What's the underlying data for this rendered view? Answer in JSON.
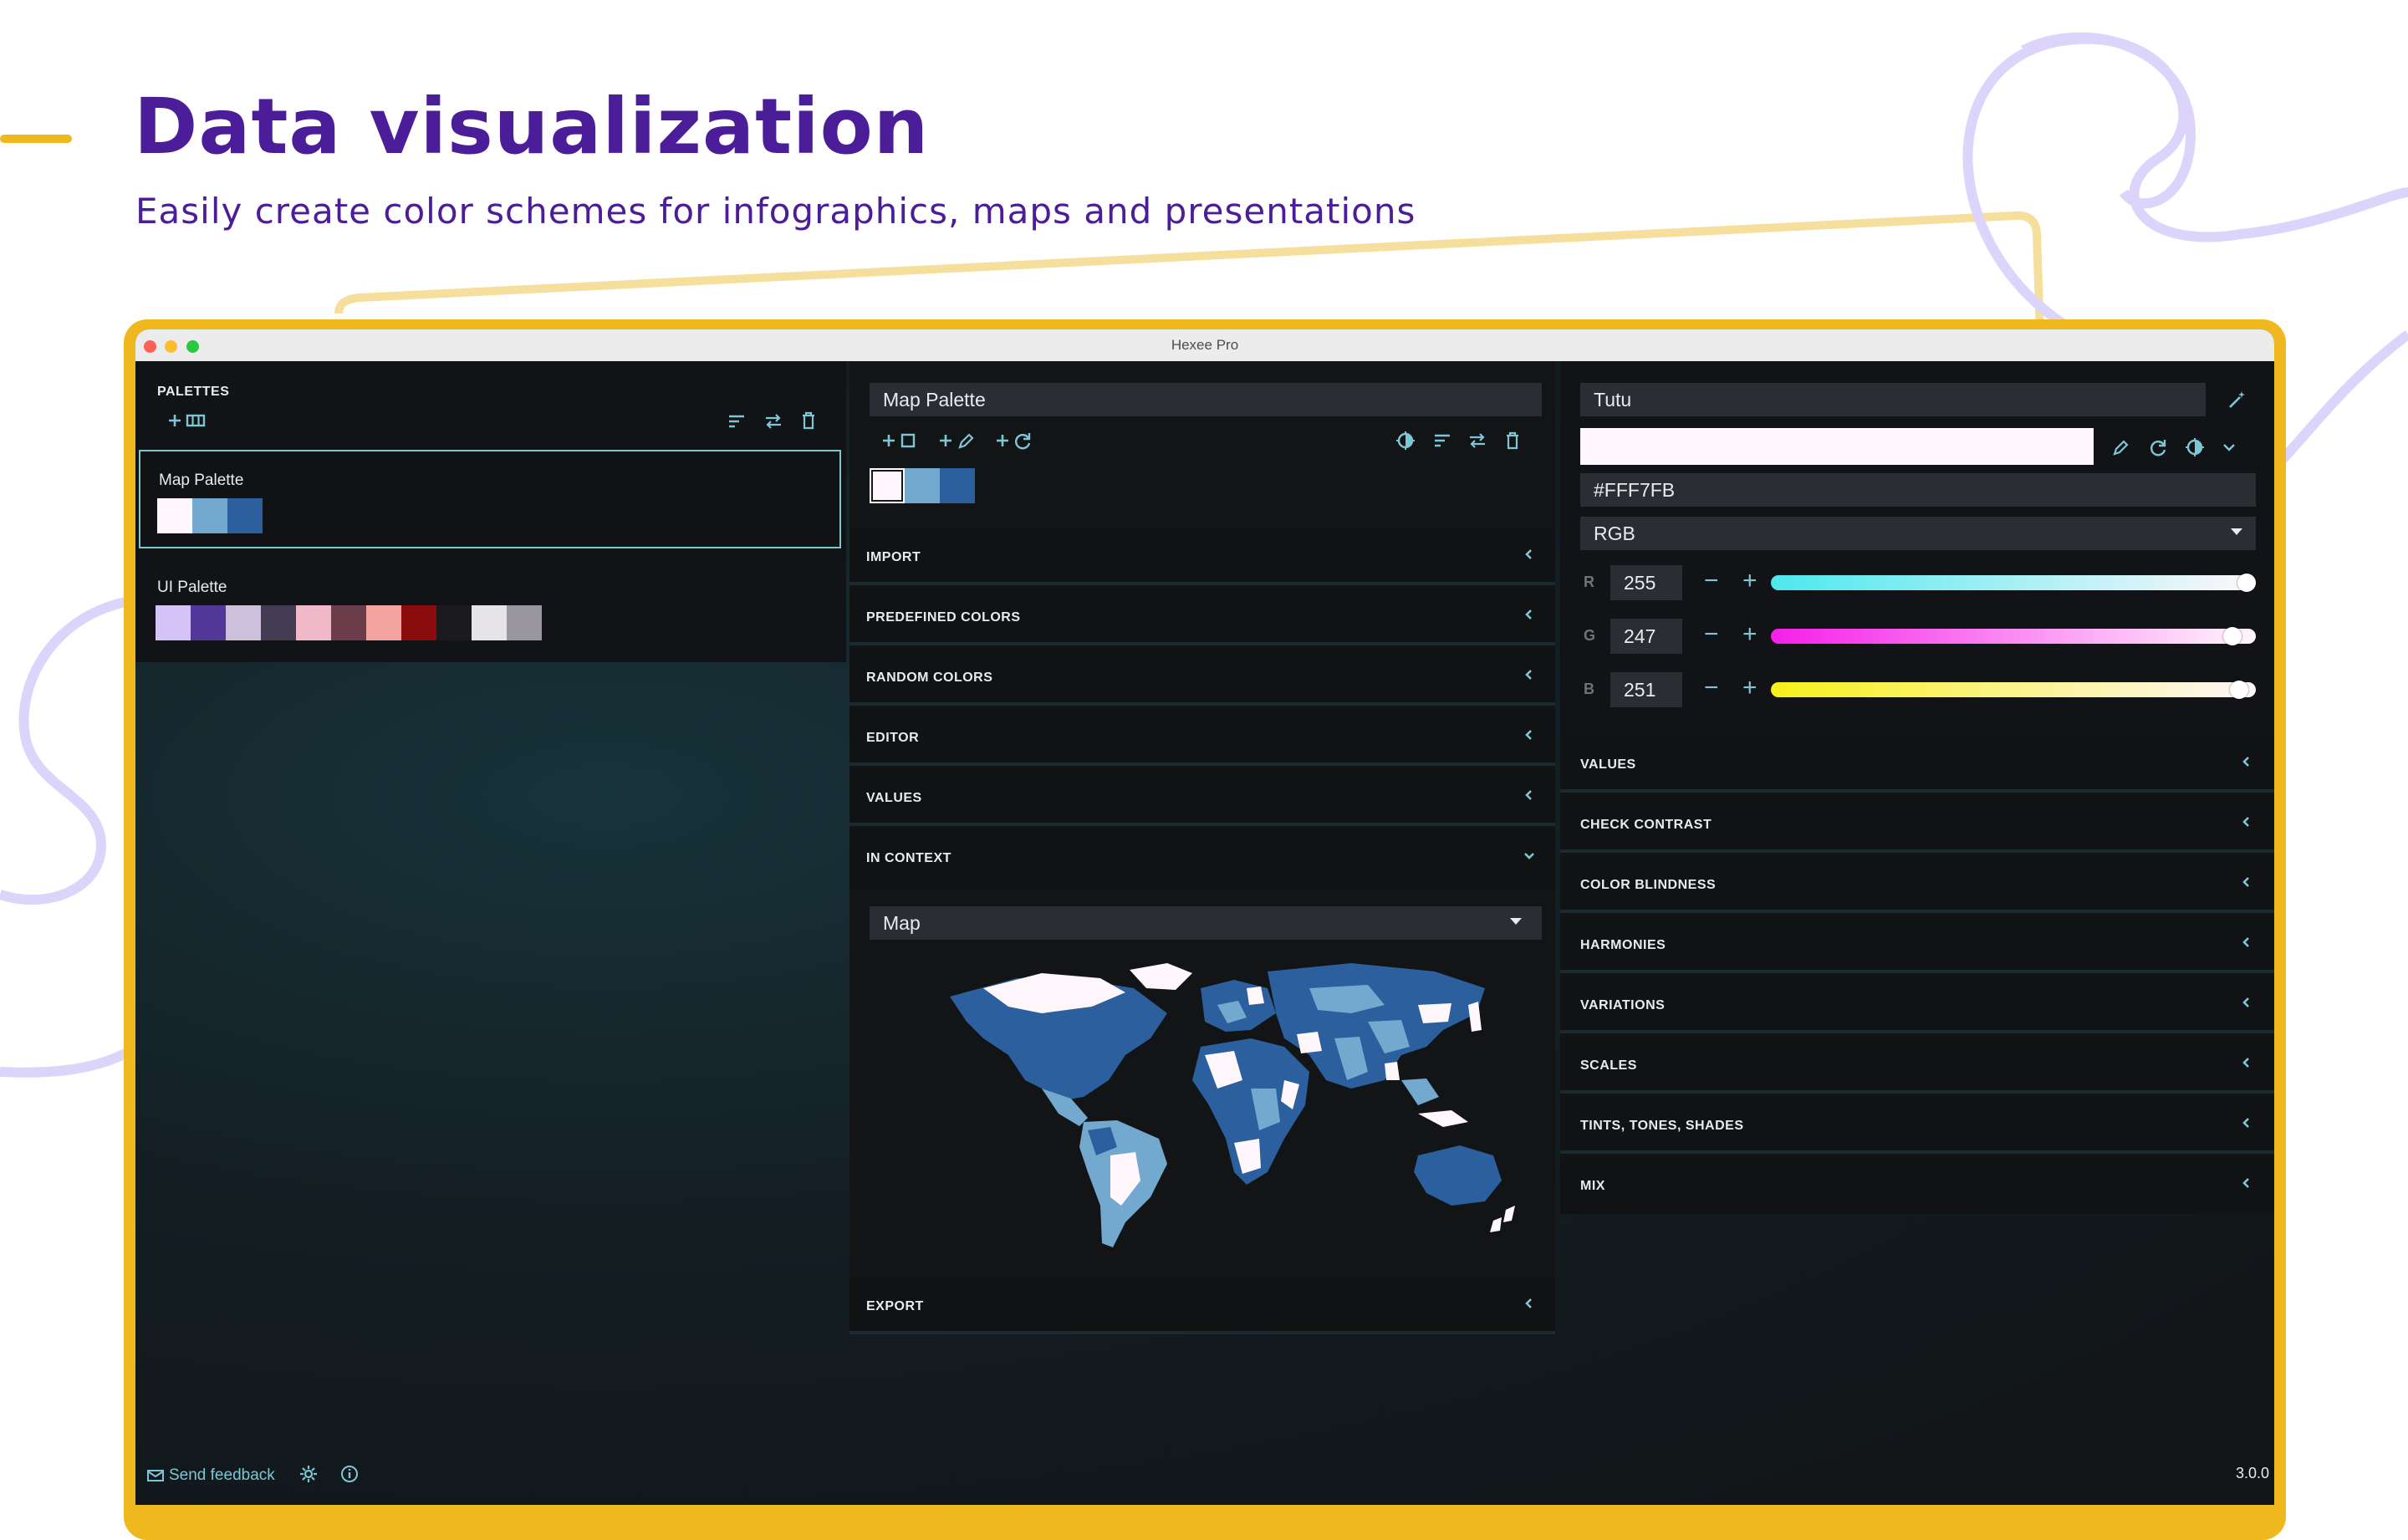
{
  "header": {
    "title": "Data visualization",
    "subtitle": "Easily create color schemes for infographics, maps and presentations"
  },
  "colors": {
    "brand_purple": "#4b1d98",
    "frame_yellow": "#f0b81f",
    "accent_teal": "#7fc6d4",
    "deco_lavender": "#dcd4fb"
  },
  "window": {
    "title": "Hexee Pro"
  },
  "palettes_panel": {
    "section_label": "PALETTES",
    "icons": [
      "add-palette-icon",
      "sort-icon",
      "swap-icon",
      "trash-icon"
    ],
    "items": [
      {
        "name": "Map Palette",
        "selected": true,
        "swatches": [
          "#fff7fb",
          "#74a9cf",
          "#2b5f9e"
        ]
      },
      {
        "name": "UI Palette",
        "selected": false,
        "swatches": [
          "#d5c2f6",
          "#53389a",
          "#ccc0dc",
          "#423b52",
          "#f0b8c9",
          "#6b3c4a",
          "#f5a3a0",
          "#8a0c0c",
          "#1b1b1d",
          "#e6e4e8",
          "#9a96a0"
        ]
      }
    ]
  },
  "palette_editor": {
    "name_value": "Map Palette",
    "toolbar_icons": [
      "add-color-icon",
      "add-picker-icon",
      "add-random-icon",
      "contrast-icon",
      "sort-icon",
      "swap-icon",
      "trash-icon"
    ],
    "swatches": [
      "#fff7fb",
      "#74a9cf",
      "#2b5f9e"
    ],
    "sections": [
      "IMPORT",
      "PREDEFINED COLORS",
      "RANDOM COLORS",
      "EDITOR",
      "VALUES",
      "IN CONTEXT",
      "EXPORT"
    ],
    "context_select": "Map"
  },
  "color_panel": {
    "name_value": "Tutu",
    "hex_value": "#FFF7FB",
    "color": "#fff7fb",
    "mode_select": "RGB",
    "channels": [
      {
        "letter": "R",
        "value": "255",
        "fraction": 1.0
      },
      {
        "letter": "G",
        "value": "247",
        "fraction": 0.969
      },
      {
        "letter": "B",
        "value": "251",
        "fraction": 0.984
      }
    ],
    "sections": [
      "VALUES",
      "CHECK CONTRAST",
      "COLOR BLINDNESS",
      "HARMONIES",
      "VARIATIONS",
      "SCALES",
      "TINTS, TONES, SHADES",
      "MIX"
    ]
  },
  "footer": {
    "feedback_label": "Send feedback",
    "version": "3.0.0"
  }
}
